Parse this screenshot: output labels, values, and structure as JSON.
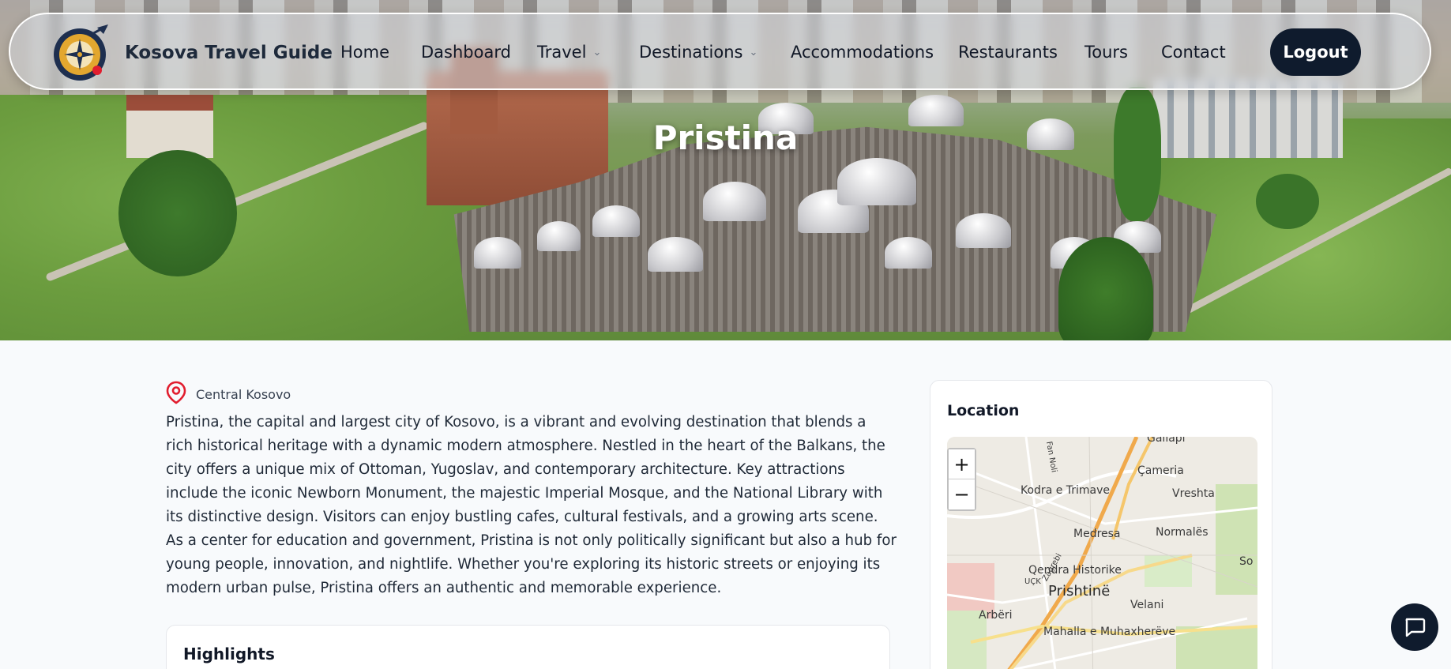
{
  "navbar": {
    "brand": "Kosova Travel Guide",
    "items": [
      {
        "label": "Home",
        "dropdown": false
      },
      {
        "label": "Dashboard",
        "dropdown": false
      },
      {
        "label": "Travel",
        "dropdown": true
      },
      {
        "label": "Destinations",
        "dropdown": true
      },
      {
        "label": "Accommodations",
        "dropdown": false
      },
      {
        "label": "Restaurants",
        "dropdown": false
      },
      {
        "label": "Tours",
        "dropdown": false
      },
      {
        "label": "Contact",
        "dropdown": false
      }
    ],
    "logout_label": "Logout"
  },
  "hero": {
    "title": "Pristina"
  },
  "destination": {
    "region": "Central Kosovo",
    "description": "Pristina, the capital and largest city of Kosovo, is a vibrant and evolving destination that blends a rich historical heritage with a dynamic modern atmosphere. Nestled in the heart of the Balkans, the city offers a unique mix of Ottoman, Yugoslav, and contemporary architecture. Key attractions include the iconic Newborn Monument, the majestic Imperial Mosque, and the National Library with its distinctive design. Visitors can enjoy bustling cafes, cultural festivals, and a growing arts scene. As a center for education and government, Pristina is not only politically significant but also a hub for young people, innovation, and nightlife. Whether you're exploring its historic streets or enjoying its modern urban pulse, Pristina offers an authentic and memorable experience."
  },
  "highlights": {
    "title": "Highlights"
  },
  "location_card": {
    "title": "Location",
    "zoom_in": "+",
    "zoom_out": "−",
    "map_labels": {
      "gallapi": "Gallapi",
      "kodra": "Kodra e Trimave",
      "cameria": "Çameria",
      "vreshta": "Vreshta",
      "medresa": "Medresa",
      "normales": "Normalës",
      "qendra": "Qendra Historike",
      "prishtine": "Prishtinë",
      "velani": "Velani",
      "arberi": "Arbëri",
      "mahalla": "Mahalla e Muhaxherëve",
      "fan_noli": "Fan Noli",
      "ucк": "UÇK",
      "zagrebi": "Zagrebi",
      "so": "So"
    }
  },
  "icons": {
    "location_pin": "map-pin-icon",
    "chat": "chat-icon",
    "logo": "compass-plane-logo"
  },
  "colors": {
    "accent_dark": "#0f1b2d",
    "pin_red": "#e11d2e",
    "logo_gold": "#e3a72f"
  }
}
